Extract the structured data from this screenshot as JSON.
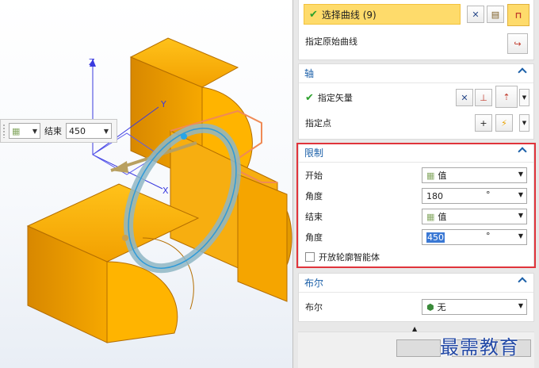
{
  "viewport": {
    "axis_z": "Z",
    "axis_y": "Y",
    "axis_x": "X"
  },
  "mini_toolbar": {
    "end_label": "结束",
    "end_value": "450"
  },
  "select_curve": {
    "label": "选择曲线 (9)"
  },
  "specify_original_curve": {
    "label": "指定原始曲线"
  },
  "axis_group": {
    "title": "轴",
    "specify_vector": "指定矢量",
    "specify_point": "指定点"
  },
  "limits_group": {
    "title": "限制",
    "start_label": "开始",
    "start_value": "值",
    "start_angle_label": "角度",
    "start_angle_value": "180",
    "start_angle_unit": "°",
    "end_label": "结束",
    "end_value": "值",
    "end_angle_label": "角度",
    "end_angle_value": "450",
    "end_angle_unit": "°",
    "open_profile_label": "开放轮廓智能体"
  },
  "boolean_group": {
    "title": "布尔",
    "boolean_label": "布尔",
    "boolean_value": "无"
  },
  "watermark": "最需教育",
  "colors": {
    "accent": "#1a5fa8",
    "highlight": "#fedb6b",
    "frame_red": "#e0343b",
    "model_orange": "#f5a300"
  }
}
